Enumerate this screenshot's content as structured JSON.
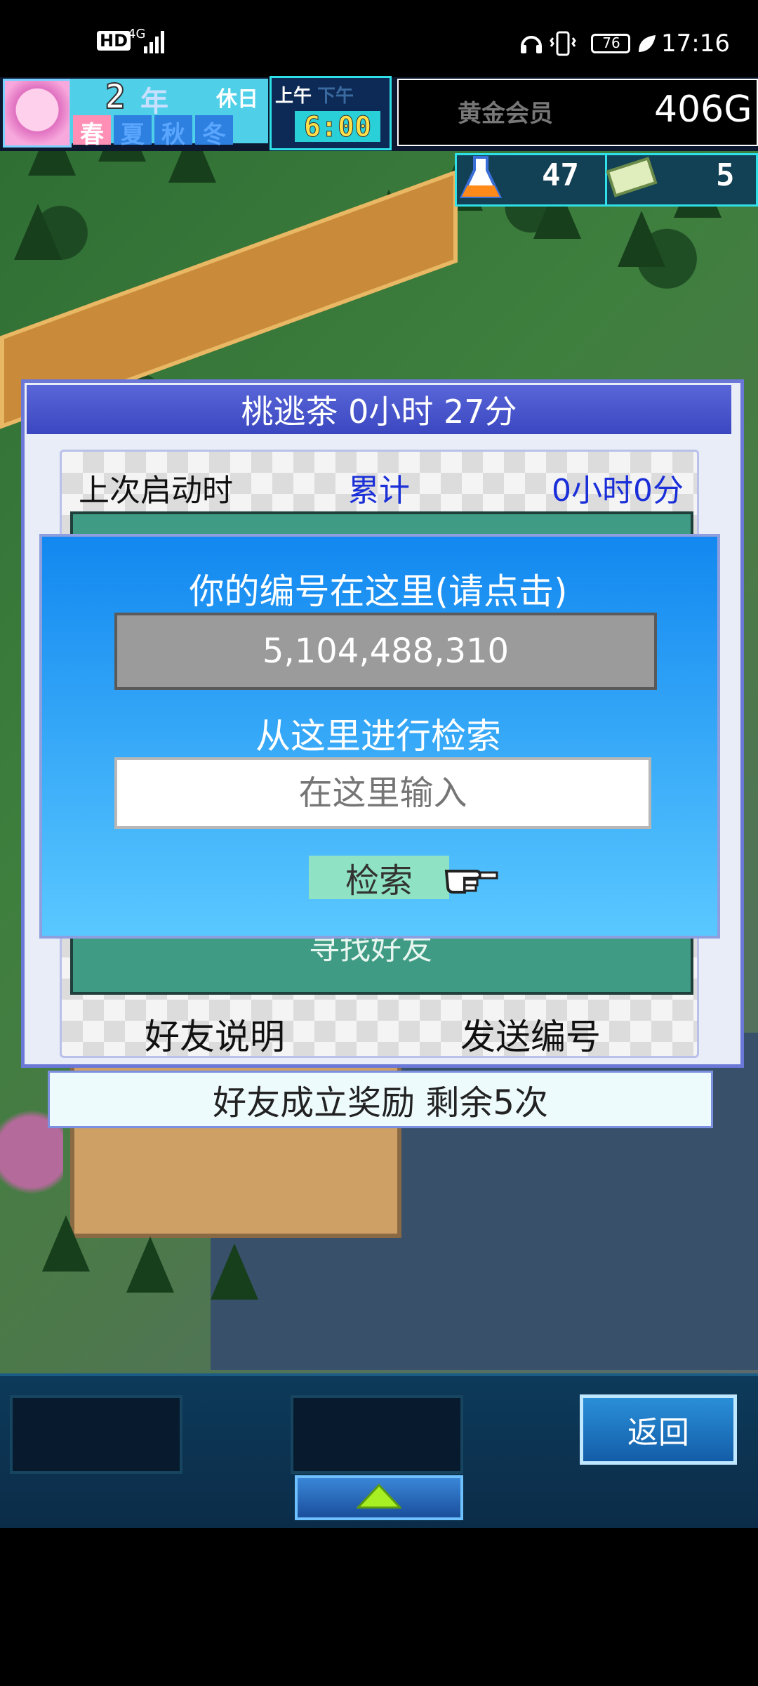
{
  "status_bar": {
    "hd": "HD",
    "network": "4G",
    "battery": "76",
    "time": "17:16"
  },
  "hud": {
    "year": "2",
    "year_unit": "年",
    "holiday": "休日",
    "seasons": [
      "春",
      "夏",
      "秋",
      "冬"
    ],
    "am": "上午",
    "pm": "下午",
    "clock": "6:00",
    "member": "黄金会员",
    "gold": "406G",
    "research_points": "47",
    "tickets": "5"
  },
  "dialog": {
    "title": "桃逃茶  0小时 27分",
    "last_start_label": "上次启动时",
    "total_label": "累计",
    "total_value": "0小时0分",
    "find_friends": "寻找好友",
    "friend_info": "好友说明",
    "send_id": "发送编号"
  },
  "id_panel": {
    "id_label": "你的编号在这里(请点击)",
    "id_value": "5,104,488,310",
    "search_label": "从这里进行检索",
    "search_placeholder": "在这里输入",
    "search_button": "检索"
  },
  "reward_text": "好友成立奖励  剩余5次",
  "bottom": {
    "back_button": "返回"
  }
}
